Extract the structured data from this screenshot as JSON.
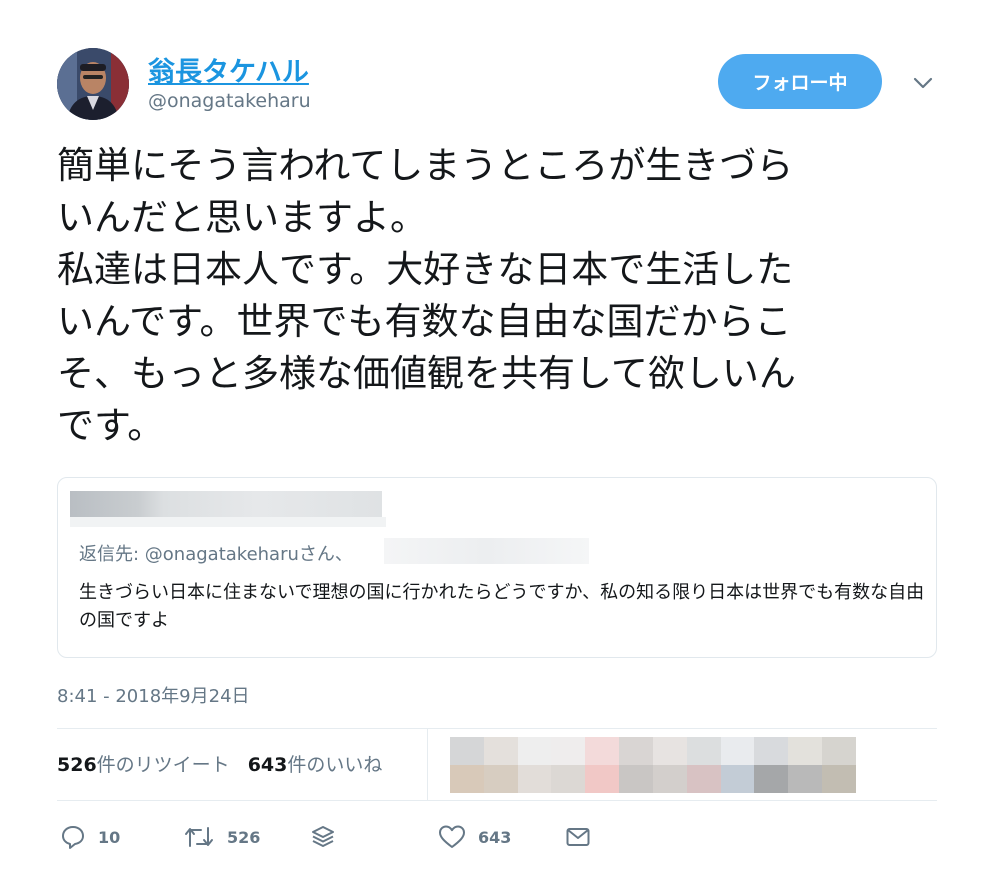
{
  "user": {
    "display_name": "翁長タケハル",
    "handle": "@onagatakeharu"
  },
  "follow_button_label": "フォロー中",
  "tweet_lines": [
    "簡単にそう言われてしまうところが生きづら",
    "いんだと思いますよ。",
    "私達は日本人です。大好きな日本で生活した",
    "いんです。世界でも有数な自由な国だからこ",
    "そ、もっと多様な価値観を共有して欲しいん",
    "です。"
  ],
  "quoted_tweet": {
    "reply_to_label": "返信先: @onagatakeharuさん、",
    "text": "生きづらい日本に住まないで理想の国に行かれたらどうですか、私の知る限り日本は世界でも有数な自由の国ですよ"
  },
  "timestamp": "8:41 - 2018年9月24日",
  "stats": {
    "retweet_count": "526",
    "retweet_label": "件のリツイート",
    "like_count": "643",
    "like_label": "件のいいね"
  },
  "actions": {
    "reply_count": "10",
    "retweet_count": "526",
    "like_count": "643"
  },
  "icons": {
    "avatar": "avatar-photo",
    "caret": "chevron-down-icon",
    "reply": "reply-icon",
    "retweet": "retweet-icon",
    "stack": "layers-icon",
    "like": "heart-icon",
    "dm": "envelope-icon"
  },
  "colors": {
    "link": "#1b95e0",
    "follow_button": "#4eaaf0",
    "muted": "#657786",
    "text": "#14171a"
  }
}
